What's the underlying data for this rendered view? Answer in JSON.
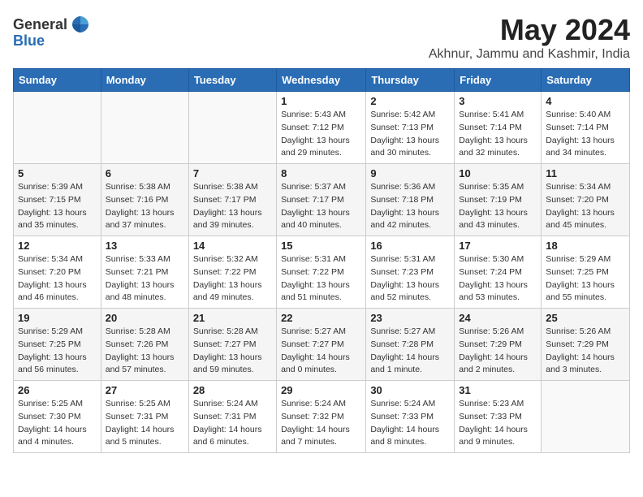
{
  "logo": {
    "text_general": "General",
    "text_blue": "Blue"
  },
  "title": "May 2024",
  "subtitle": "Akhnur, Jammu and Kashmir, India",
  "weekdays": [
    "Sunday",
    "Monday",
    "Tuesday",
    "Wednesday",
    "Thursday",
    "Friday",
    "Saturday"
  ],
  "weeks": [
    [
      {
        "day": "",
        "info": ""
      },
      {
        "day": "",
        "info": ""
      },
      {
        "day": "",
        "info": ""
      },
      {
        "day": "1",
        "info": "Sunrise: 5:43 AM\nSunset: 7:12 PM\nDaylight: 13 hours\nand 29 minutes."
      },
      {
        "day": "2",
        "info": "Sunrise: 5:42 AM\nSunset: 7:13 PM\nDaylight: 13 hours\nand 30 minutes."
      },
      {
        "day": "3",
        "info": "Sunrise: 5:41 AM\nSunset: 7:14 PM\nDaylight: 13 hours\nand 32 minutes."
      },
      {
        "day": "4",
        "info": "Sunrise: 5:40 AM\nSunset: 7:14 PM\nDaylight: 13 hours\nand 34 minutes."
      }
    ],
    [
      {
        "day": "5",
        "info": "Sunrise: 5:39 AM\nSunset: 7:15 PM\nDaylight: 13 hours\nand 35 minutes."
      },
      {
        "day": "6",
        "info": "Sunrise: 5:38 AM\nSunset: 7:16 PM\nDaylight: 13 hours\nand 37 minutes."
      },
      {
        "day": "7",
        "info": "Sunrise: 5:38 AM\nSunset: 7:17 PM\nDaylight: 13 hours\nand 39 minutes."
      },
      {
        "day": "8",
        "info": "Sunrise: 5:37 AM\nSunset: 7:17 PM\nDaylight: 13 hours\nand 40 minutes."
      },
      {
        "day": "9",
        "info": "Sunrise: 5:36 AM\nSunset: 7:18 PM\nDaylight: 13 hours\nand 42 minutes."
      },
      {
        "day": "10",
        "info": "Sunrise: 5:35 AM\nSunset: 7:19 PM\nDaylight: 13 hours\nand 43 minutes."
      },
      {
        "day": "11",
        "info": "Sunrise: 5:34 AM\nSunset: 7:20 PM\nDaylight: 13 hours\nand 45 minutes."
      }
    ],
    [
      {
        "day": "12",
        "info": "Sunrise: 5:34 AM\nSunset: 7:20 PM\nDaylight: 13 hours\nand 46 minutes."
      },
      {
        "day": "13",
        "info": "Sunrise: 5:33 AM\nSunset: 7:21 PM\nDaylight: 13 hours\nand 48 minutes."
      },
      {
        "day": "14",
        "info": "Sunrise: 5:32 AM\nSunset: 7:22 PM\nDaylight: 13 hours\nand 49 minutes."
      },
      {
        "day": "15",
        "info": "Sunrise: 5:31 AM\nSunset: 7:22 PM\nDaylight: 13 hours\nand 51 minutes."
      },
      {
        "day": "16",
        "info": "Sunrise: 5:31 AM\nSunset: 7:23 PM\nDaylight: 13 hours\nand 52 minutes."
      },
      {
        "day": "17",
        "info": "Sunrise: 5:30 AM\nSunset: 7:24 PM\nDaylight: 13 hours\nand 53 minutes."
      },
      {
        "day": "18",
        "info": "Sunrise: 5:29 AM\nSunset: 7:25 PM\nDaylight: 13 hours\nand 55 minutes."
      }
    ],
    [
      {
        "day": "19",
        "info": "Sunrise: 5:29 AM\nSunset: 7:25 PM\nDaylight: 13 hours\nand 56 minutes."
      },
      {
        "day": "20",
        "info": "Sunrise: 5:28 AM\nSunset: 7:26 PM\nDaylight: 13 hours\nand 57 minutes."
      },
      {
        "day": "21",
        "info": "Sunrise: 5:28 AM\nSunset: 7:27 PM\nDaylight: 13 hours\nand 59 minutes."
      },
      {
        "day": "22",
        "info": "Sunrise: 5:27 AM\nSunset: 7:27 PM\nDaylight: 14 hours\nand 0 minutes."
      },
      {
        "day": "23",
        "info": "Sunrise: 5:27 AM\nSunset: 7:28 PM\nDaylight: 14 hours\nand 1 minute."
      },
      {
        "day": "24",
        "info": "Sunrise: 5:26 AM\nSunset: 7:29 PM\nDaylight: 14 hours\nand 2 minutes."
      },
      {
        "day": "25",
        "info": "Sunrise: 5:26 AM\nSunset: 7:29 PM\nDaylight: 14 hours\nand 3 minutes."
      }
    ],
    [
      {
        "day": "26",
        "info": "Sunrise: 5:25 AM\nSunset: 7:30 PM\nDaylight: 14 hours\nand 4 minutes."
      },
      {
        "day": "27",
        "info": "Sunrise: 5:25 AM\nSunset: 7:31 PM\nDaylight: 14 hours\nand 5 minutes."
      },
      {
        "day": "28",
        "info": "Sunrise: 5:24 AM\nSunset: 7:31 PM\nDaylight: 14 hours\nand 6 minutes."
      },
      {
        "day": "29",
        "info": "Sunrise: 5:24 AM\nSunset: 7:32 PM\nDaylight: 14 hours\nand 7 minutes."
      },
      {
        "day": "30",
        "info": "Sunrise: 5:24 AM\nSunset: 7:33 PM\nDaylight: 14 hours\nand 8 minutes."
      },
      {
        "day": "31",
        "info": "Sunrise: 5:23 AM\nSunset: 7:33 PM\nDaylight: 14 hours\nand 9 minutes."
      },
      {
        "day": "",
        "info": ""
      }
    ]
  ]
}
